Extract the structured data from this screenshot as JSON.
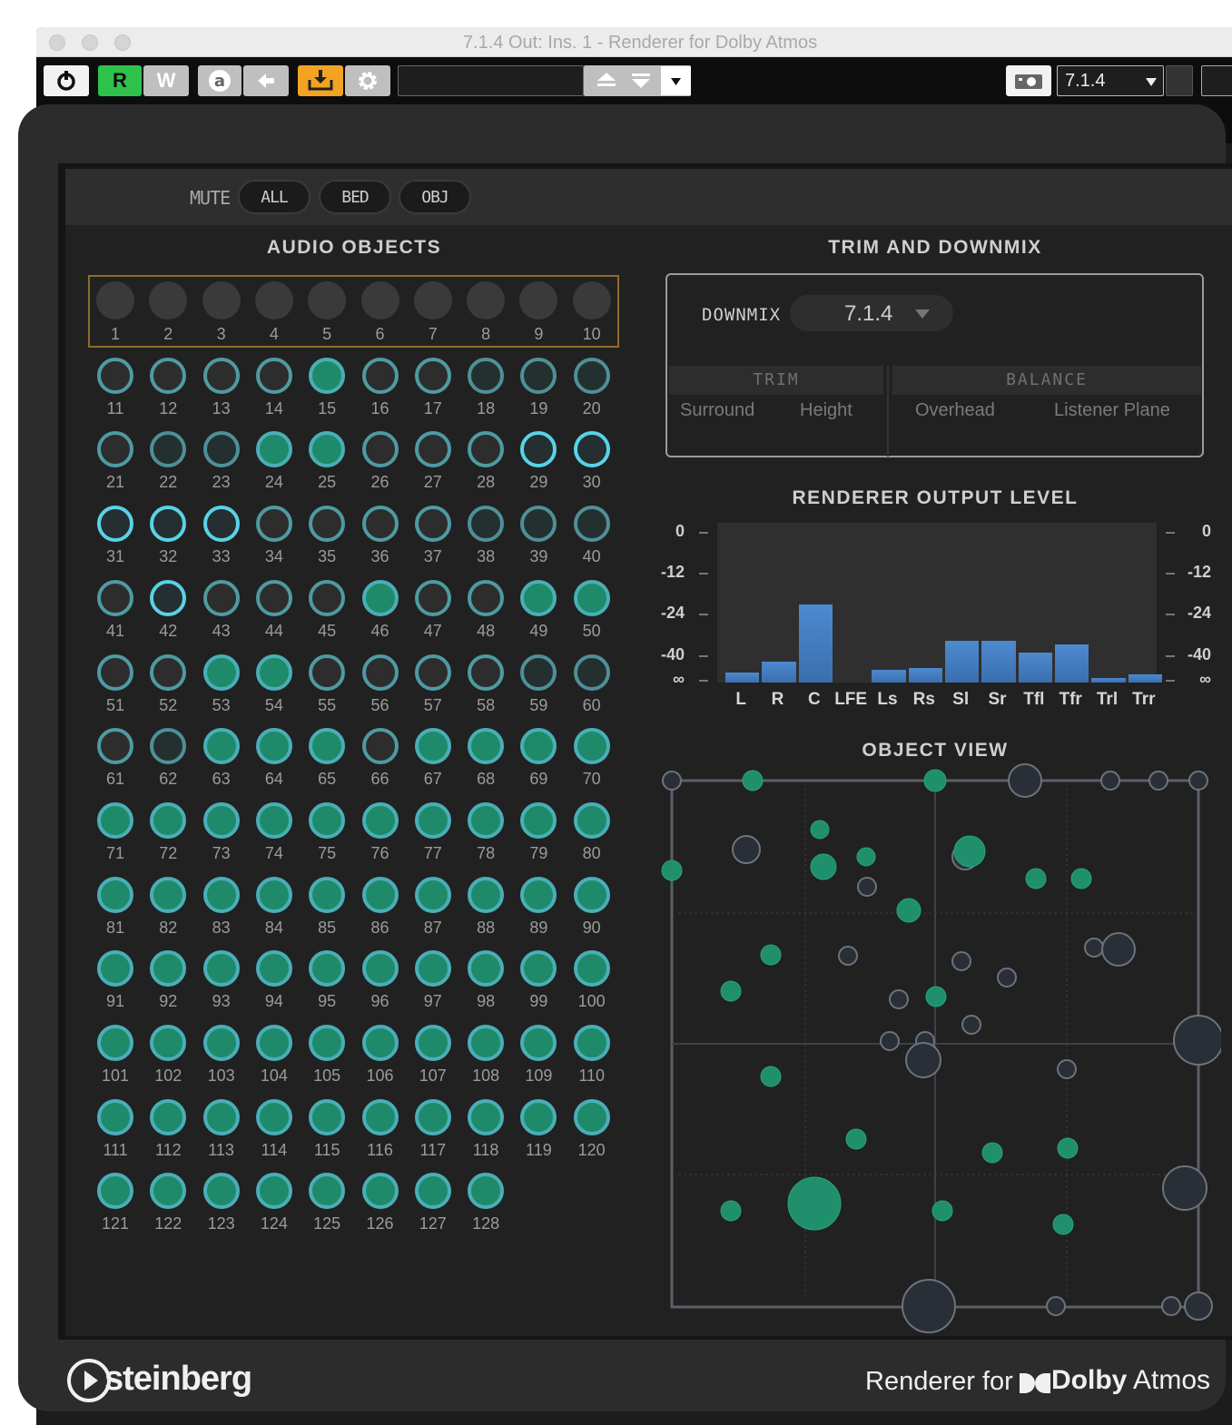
{
  "window": {
    "title": "7.1.4 Out: Ins. 1 - Renderer for Dolby Atmos"
  },
  "toolbar": {
    "read_label": "R",
    "write_label": "W",
    "preset_value": "",
    "output_format": "7.1.4"
  },
  "mute": {
    "label": "MUTE",
    "all_label": "ALL",
    "bed_label": "BED",
    "obj_label": "OBJ"
  },
  "audio_objects": {
    "title": "AUDIO OBJECTS",
    "objects": [
      {
        "n": "1",
        "s": "bed"
      },
      {
        "n": "2",
        "s": "bed"
      },
      {
        "n": "3",
        "s": "bed"
      },
      {
        "n": "4",
        "s": "bed"
      },
      {
        "n": "5",
        "s": "bed"
      },
      {
        "n": "6",
        "s": "bed"
      },
      {
        "n": "7",
        "s": "bed"
      },
      {
        "n": "8",
        "s": "bed"
      },
      {
        "n": "9",
        "s": "bed"
      },
      {
        "n": "10",
        "s": "bed"
      },
      {
        "n": "11",
        "s": "off"
      },
      {
        "n": "12",
        "s": "off"
      },
      {
        "n": "13",
        "s": "off"
      },
      {
        "n": "14",
        "s": "off"
      },
      {
        "n": "15",
        "s": "active"
      },
      {
        "n": "16",
        "s": "off"
      },
      {
        "n": "17",
        "s": "off"
      },
      {
        "n": "18",
        "s": "dim"
      },
      {
        "n": "19",
        "s": "dim"
      },
      {
        "n": "20",
        "s": "dim"
      },
      {
        "n": "21",
        "s": "off"
      },
      {
        "n": "22",
        "s": "dim"
      },
      {
        "n": "23",
        "s": "dim"
      },
      {
        "n": "24",
        "s": "active"
      },
      {
        "n": "25",
        "s": "active"
      },
      {
        "n": "26",
        "s": "off"
      },
      {
        "n": "27",
        "s": "off"
      },
      {
        "n": "28",
        "s": "off"
      },
      {
        "n": "29",
        "s": "bright"
      },
      {
        "n": "30",
        "s": "bright"
      },
      {
        "n": "31",
        "s": "bright"
      },
      {
        "n": "32",
        "s": "bright"
      },
      {
        "n": "33",
        "s": "bright"
      },
      {
        "n": "34",
        "s": "off"
      },
      {
        "n": "35",
        "s": "off"
      },
      {
        "n": "36",
        "s": "off"
      },
      {
        "n": "37",
        "s": "off"
      },
      {
        "n": "38",
        "s": "dim"
      },
      {
        "n": "39",
        "s": "dim"
      },
      {
        "n": "40",
        "s": "dim"
      },
      {
        "n": "41",
        "s": "off"
      },
      {
        "n": "42",
        "s": "bright"
      },
      {
        "n": "43",
        "s": "off"
      },
      {
        "n": "44",
        "s": "off"
      },
      {
        "n": "45",
        "s": "off"
      },
      {
        "n": "46",
        "s": "active"
      },
      {
        "n": "47",
        "s": "off"
      },
      {
        "n": "48",
        "s": "off"
      },
      {
        "n": "49",
        "s": "active"
      },
      {
        "n": "50",
        "s": "active"
      },
      {
        "n": "51",
        "s": "off"
      },
      {
        "n": "52",
        "s": "off"
      },
      {
        "n": "53",
        "s": "active"
      },
      {
        "n": "54",
        "s": "active"
      },
      {
        "n": "55",
        "s": "off"
      },
      {
        "n": "56",
        "s": "off"
      },
      {
        "n": "57",
        "s": "off"
      },
      {
        "n": "58",
        "s": "off"
      },
      {
        "n": "59",
        "s": "dim"
      },
      {
        "n": "60",
        "s": "dim"
      },
      {
        "n": "61",
        "s": "off"
      },
      {
        "n": "62",
        "s": "dim"
      },
      {
        "n": "63",
        "s": "active"
      },
      {
        "n": "64",
        "s": "active"
      },
      {
        "n": "65",
        "s": "active"
      },
      {
        "n": "66",
        "s": "off"
      },
      {
        "n": "67",
        "s": "active"
      },
      {
        "n": "68",
        "s": "active"
      },
      {
        "n": "69",
        "s": "active"
      },
      {
        "n": "70",
        "s": "active"
      },
      {
        "n": "71",
        "s": "active"
      },
      {
        "n": "72",
        "s": "active"
      },
      {
        "n": "73",
        "s": "active"
      },
      {
        "n": "74",
        "s": "active"
      },
      {
        "n": "75",
        "s": "active"
      },
      {
        "n": "76",
        "s": "active"
      },
      {
        "n": "77",
        "s": "active"
      },
      {
        "n": "78",
        "s": "active"
      },
      {
        "n": "79",
        "s": "active"
      },
      {
        "n": "80",
        "s": "active"
      },
      {
        "n": "81",
        "s": "active"
      },
      {
        "n": "82",
        "s": "active"
      },
      {
        "n": "83",
        "s": "active"
      },
      {
        "n": "84",
        "s": "active"
      },
      {
        "n": "85",
        "s": "active"
      },
      {
        "n": "86",
        "s": "active"
      },
      {
        "n": "87",
        "s": "active"
      },
      {
        "n": "88",
        "s": "active"
      },
      {
        "n": "89",
        "s": "active"
      },
      {
        "n": "90",
        "s": "active"
      },
      {
        "n": "91",
        "s": "active"
      },
      {
        "n": "92",
        "s": "active"
      },
      {
        "n": "93",
        "s": "active"
      },
      {
        "n": "94",
        "s": "active"
      },
      {
        "n": "95",
        "s": "active"
      },
      {
        "n": "96",
        "s": "active"
      },
      {
        "n": "97",
        "s": "active"
      },
      {
        "n": "98",
        "s": "active"
      },
      {
        "n": "99",
        "s": "active"
      },
      {
        "n": "100",
        "s": "active"
      },
      {
        "n": "101",
        "s": "active"
      },
      {
        "n": "102",
        "s": "active"
      },
      {
        "n": "103",
        "s": "active"
      },
      {
        "n": "104",
        "s": "active"
      },
      {
        "n": "105",
        "s": "active"
      },
      {
        "n": "106",
        "s": "active"
      },
      {
        "n": "107",
        "s": "active"
      },
      {
        "n": "108",
        "s": "active"
      },
      {
        "n": "109",
        "s": "active"
      },
      {
        "n": "110",
        "s": "active"
      },
      {
        "n": "111",
        "s": "active"
      },
      {
        "n": "112",
        "s": "active"
      },
      {
        "n": "113",
        "s": "active"
      },
      {
        "n": "114",
        "s": "active"
      },
      {
        "n": "115",
        "s": "active"
      },
      {
        "n": "116",
        "s": "active"
      },
      {
        "n": "117",
        "s": "active"
      },
      {
        "n": "118",
        "s": "active"
      },
      {
        "n": "119",
        "s": "active"
      },
      {
        "n": "120",
        "s": "active"
      },
      {
        "n": "121",
        "s": "active"
      },
      {
        "n": "122",
        "s": "active"
      },
      {
        "n": "123",
        "s": "active"
      },
      {
        "n": "124",
        "s": "active"
      },
      {
        "n": "125",
        "s": "active"
      },
      {
        "n": "126",
        "s": "active"
      },
      {
        "n": "127",
        "s": "active"
      },
      {
        "n": "128",
        "s": "active"
      }
    ]
  },
  "trim_downmix": {
    "title": "TRIM AND DOWNMIX",
    "downmix_label": "DOWNMIX",
    "downmix_value": "7.1.4",
    "trim_label": "TRIM",
    "balance_label": "BALANCE",
    "trim_surround": "Surround",
    "trim_height": "Height",
    "balance_overhead": "Overhead",
    "balance_listener": "Listener Plane"
  },
  "output_level": {
    "title": "RENDERER OUTPUT LEVEL",
    "scale_labels": [
      "0",
      "-12",
      "-24",
      "-40",
      "∞"
    ],
    "channels": [
      "L",
      "R",
      "C",
      "LFE",
      "Ls",
      "Rs",
      "Sl",
      "Sr",
      "Tfl",
      "Tfr",
      "Trl",
      "Trr"
    ],
    "levels_fraction": [
      0.06,
      0.13,
      0.49,
      0.0,
      0.08,
      0.09,
      0.26,
      0.26,
      0.19,
      0.24,
      0.03,
      0.05
    ]
  },
  "object_view": {
    "title": "OBJECT VIEW"
  },
  "colors": {
    "active_green": "#1f8a6a",
    "ring_cyan": "#58d3e6",
    "meter_blue": "#4d8ad0",
    "bed_outline": "#8d6c2a"
  },
  "footer": {
    "brand": "steinberg",
    "product_prefix": "Renderer for",
    "product_brand": "Dolby",
    "product_suffix": "Atmos"
  }
}
